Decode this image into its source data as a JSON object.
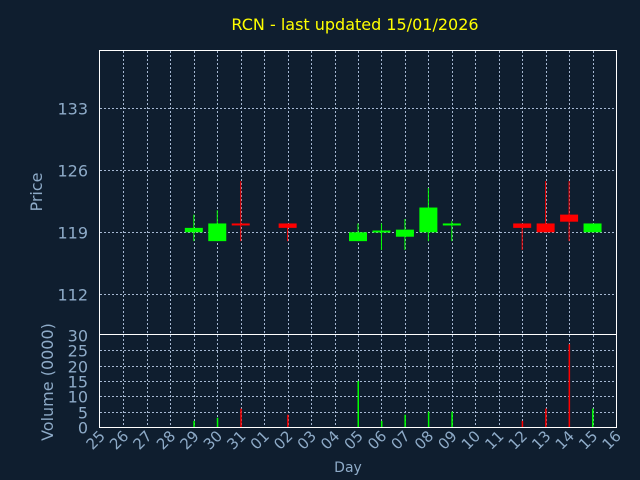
{
  "title": "RCN - last updated 15/01/2026",
  "colors": {
    "background": "#0f1e2f",
    "plot_border": "#ffffff",
    "grid": "#a6b8d2",
    "axis_text": "#8eabc8",
    "title": "#ffff00",
    "up": "#00ff00",
    "down": "#ff0000"
  },
  "chart_data": [
    {
      "type": "candlestick",
      "ylabel": "Price",
      "yticks": [
        112,
        119,
        126,
        133
      ],
      "ylim": [
        107.5,
        139.5
      ],
      "grid": true,
      "candles": [
        {
          "day": "29",
          "open": 119.0,
          "high": 121.0,
          "low": 118.0,
          "close": 119.5
        },
        {
          "day": "30",
          "open": 118.0,
          "high": 121.5,
          "low": 118.0,
          "close": 120.0
        },
        {
          "day": "31",
          "open": 120.0,
          "high": 124.8,
          "low": 118.0,
          "close": 119.8
        },
        {
          "day": "02",
          "open": 120.0,
          "high": 120.0,
          "low": 118.0,
          "close": 119.5
        },
        {
          "day": "05",
          "open": 118.0,
          "high": 120.0,
          "low": 118.0,
          "close": 119.0
        },
        {
          "day": "06",
          "open": 119.0,
          "high": 120.0,
          "low": 117.0,
          "close": 119.2
        },
        {
          "day": "07",
          "open": 118.5,
          "high": 120.5,
          "low": 117.0,
          "close": 119.3
        },
        {
          "day": "08",
          "open": 119.0,
          "high": 124.0,
          "low": 118.0,
          "close": 121.8
        },
        {
          "day": "09",
          "open": 120.0,
          "high": 120.3,
          "low": 118.0,
          "close": 120.0
        },
        {
          "day": "12",
          "open": 120.0,
          "high": 120.0,
          "low": 117.0,
          "close": 119.5
        },
        {
          "day": "13",
          "open": 120.0,
          "high": 124.8,
          "low": 119.0,
          "close": 119.0
        },
        {
          "day": "14",
          "open": 121.0,
          "high": 124.8,
          "low": 118.0,
          "close": 120.2
        },
        {
          "day": "15",
          "open": 119.0,
          "high": 120.0,
          "low": 119.0,
          "close": 120.0
        }
      ]
    },
    {
      "type": "bar",
      "ylabel": "Volume (0000)",
      "xlabel": "Day",
      "yticks": [
        0,
        5,
        10,
        15,
        20,
        25,
        30
      ],
      "ylim": [
        0,
        30
      ],
      "grid": true,
      "categories": [
        "25",
        "26",
        "27",
        "28",
        "29",
        "30",
        "31",
        "01",
        "02",
        "03",
        "04",
        "05",
        "06",
        "07",
        "08",
        "09",
        "10",
        "11",
        "12",
        "13",
        "14",
        "15",
        "16"
      ],
      "values": [
        0,
        0,
        0,
        0,
        2,
        3,
        6,
        0,
        4,
        0,
        0,
        15,
        2,
        4,
        5,
        5,
        0,
        0,
        2,
        6,
        27,
        6,
        0
      ],
      "direction": [
        "",
        "",
        "",
        "",
        "up",
        "up",
        "down",
        "",
        "down",
        "",
        "",
        "up",
        "up",
        "up",
        "up",
        "up",
        "",
        "",
        "down",
        "down",
        "down",
        "up",
        ""
      ]
    }
  ]
}
